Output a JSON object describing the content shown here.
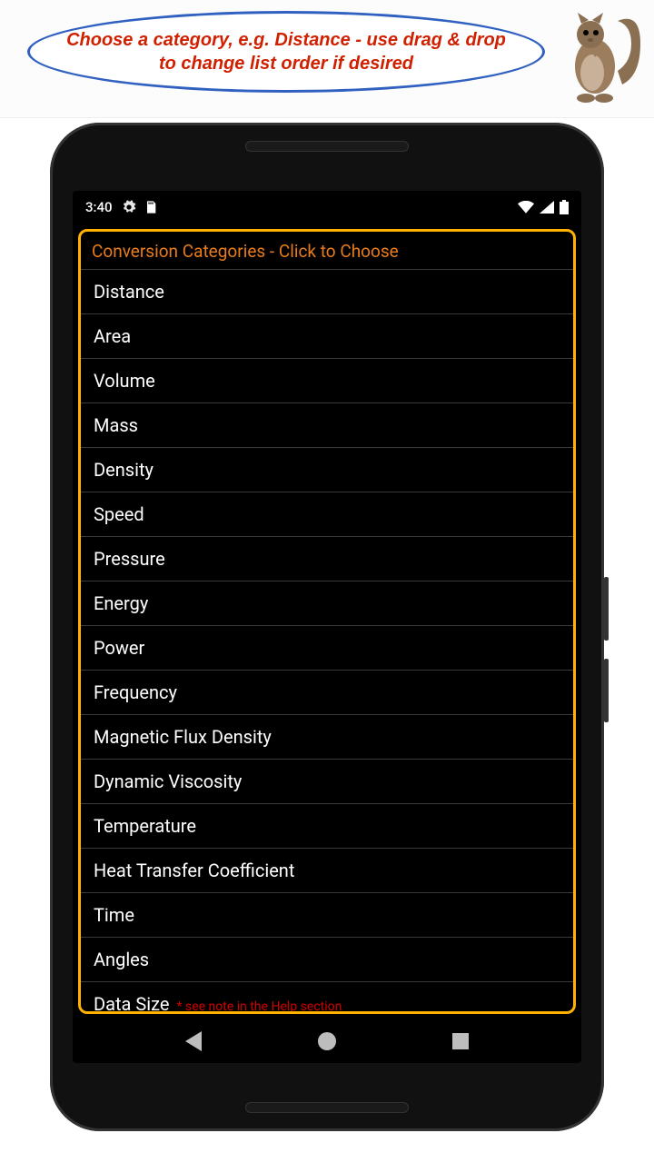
{
  "hint": {
    "text": "Choose a category, e.g. Distance - use drag & drop to change list order if desired"
  },
  "status_bar": {
    "time": "3:40"
  },
  "app": {
    "header": "Conversion Categories - Click to Choose",
    "note_text": "* see note in the Help section",
    "categories": [
      {
        "label": "Distance"
      },
      {
        "label": "Area"
      },
      {
        "label": "Volume"
      },
      {
        "label": "Mass"
      },
      {
        "label": "Density"
      },
      {
        "label": "Speed"
      },
      {
        "label": "Pressure"
      },
      {
        "label": "Energy"
      },
      {
        "label": "Power"
      },
      {
        "label": "Frequency"
      },
      {
        "label": "Magnetic Flux Density"
      },
      {
        "label": "Dynamic Viscosity"
      },
      {
        "label": "Temperature"
      },
      {
        "label": "Heat Transfer Coefficient"
      },
      {
        "label": "Time"
      },
      {
        "label": "Angles"
      },
      {
        "label": "Data Size",
        "has_note": true
      }
    ]
  }
}
